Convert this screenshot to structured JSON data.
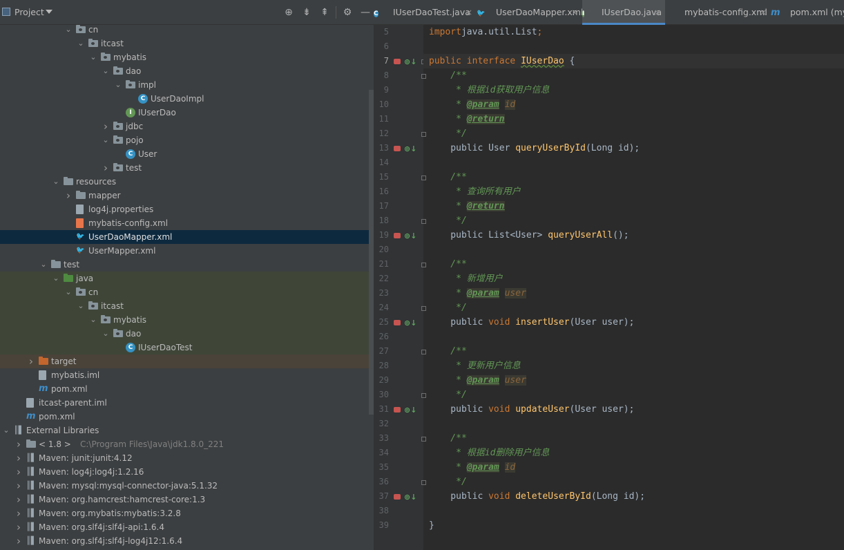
{
  "project": {
    "title": "Project",
    "tree": [
      {
        "label": "cn",
        "depth": 5,
        "arrow": "down",
        "icon": "package-folder"
      },
      {
        "label": "itcast",
        "depth": 6,
        "arrow": "down",
        "icon": "package-folder"
      },
      {
        "label": "mybatis",
        "depth": 7,
        "arrow": "down",
        "icon": "package-folder"
      },
      {
        "label": "dao",
        "depth": 8,
        "arrow": "down",
        "icon": "package-folder"
      },
      {
        "label": "impl",
        "depth": 9,
        "arrow": "down",
        "icon": "package-folder"
      },
      {
        "label": "UserDaoImpl",
        "depth": 10,
        "arrow": "",
        "icon": "class"
      },
      {
        "label": "IUserDao",
        "depth": 9,
        "arrow": "",
        "icon": "interface"
      },
      {
        "label": "jdbc",
        "depth": 8,
        "arrow": "right",
        "icon": "package-folder"
      },
      {
        "label": "pojo",
        "depth": 8,
        "arrow": "down",
        "icon": "package-folder"
      },
      {
        "label": "User",
        "depth": 9,
        "arrow": "",
        "icon": "class"
      },
      {
        "label": "test",
        "depth": 8,
        "arrow": "right",
        "icon": "package-folder"
      },
      {
        "label": "resources",
        "depth": 4,
        "arrow": "down",
        "icon": "resources-folder"
      },
      {
        "label": "mapper",
        "depth": 5,
        "arrow": "right",
        "icon": "folder"
      },
      {
        "label": "log4j.properties",
        "depth": 5,
        "arrow": "",
        "icon": "file"
      },
      {
        "label": "mybatis-config.xml",
        "depth": 5,
        "arrow": "",
        "icon": "xml"
      },
      {
        "label": "UserDaoMapper.xml",
        "depth": 5,
        "arrow": "",
        "icon": "mybatis-xml",
        "state": "selected"
      },
      {
        "label": "UserMapper.xml",
        "depth": 5,
        "arrow": "",
        "icon": "mybatis-xml"
      },
      {
        "label": "test",
        "depth": 3,
        "arrow": "down",
        "icon": "folder"
      },
      {
        "label": "java",
        "depth": 4,
        "arrow": "down",
        "icon": "green-folder",
        "state": "green"
      },
      {
        "label": "cn",
        "depth": 5,
        "arrow": "down",
        "icon": "package-folder",
        "state": "green"
      },
      {
        "label": "itcast",
        "depth": 6,
        "arrow": "down",
        "icon": "package-folder",
        "state": "green"
      },
      {
        "label": "mybatis",
        "depth": 7,
        "arrow": "down",
        "icon": "package-folder",
        "state": "green"
      },
      {
        "label": "dao",
        "depth": 8,
        "arrow": "down",
        "icon": "package-folder",
        "state": "green"
      },
      {
        "label": "IUserDaoTest",
        "depth": 9,
        "arrow": "",
        "icon": "test-class",
        "state": "green"
      },
      {
        "label": "target",
        "depth": 2,
        "arrow": "right",
        "icon": "orange-folder",
        "state": "orange"
      },
      {
        "label": "mybatis.iml",
        "depth": 2,
        "arrow": "",
        "icon": "file"
      },
      {
        "label": "pom.xml",
        "depth": 2,
        "arrow": "",
        "icon": "maven"
      },
      {
        "label": "itcast-parent.iml",
        "depth": 1,
        "arrow": "",
        "icon": "file"
      },
      {
        "label": "pom.xml",
        "depth": 1,
        "arrow": "",
        "icon": "maven"
      },
      {
        "label": "External Libraries",
        "depth": 0,
        "arrow": "down",
        "icon": "library"
      },
      {
        "label": "< 1.8 >",
        "extra": "C:\\Program Files\\Java\\jdk1.8.0_221",
        "depth": 1,
        "arrow": "right",
        "icon": "jdk"
      },
      {
        "label": "Maven: junit:junit:4.12",
        "depth": 1,
        "arrow": "right",
        "icon": "library"
      },
      {
        "label": "Maven: log4j:log4j:1.2.16",
        "depth": 1,
        "arrow": "right",
        "icon": "library"
      },
      {
        "label": "Maven: mysql:mysql-connector-java:5.1.32",
        "depth": 1,
        "arrow": "right",
        "icon": "library"
      },
      {
        "label": "Maven: org.hamcrest:hamcrest-core:1.3",
        "depth": 1,
        "arrow": "right",
        "icon": "library"
      },
      {
        "label": "Maven: org.mybatis:mybatis:3.2.8",
        "depth": 1,
        "arrow": "right",
        "icon": "library"
      },
      {
        "label": "Maven: org.slf4j:slf4j-api:1.6.4",
        "depth": 1,
        "arrow": "right",
        "icon": "library"
      },
      {
        "label": "Maven: org.slf4j:slf4j-log4j12:1.6.4",
        "depth": 1,
        "arrow": "right",
        "icon": "library"
      }
    ]
  },
  "tabs": [
    {
      "label": "IUserDaoTest.java",
      "icon": "test-class",
      "active": false
    },
    {
      "label": "UserDaoMapper.xml",
      "icon": "mybatis-xml",
      "active": false
    },
    {
      "label": "IUserDao.java",
      "icon": "interface",
      "active": true
    },
    {
      "label": "mybatis-config.xml",
      "icon": "xml",
      "active": false
    },
    {
      "label": "pom.xml (mybat",
      "icon": "maven",
      "active": false
    }
  ],
  "editor": {
    "current_line": 7,
    "lines": [
      {
        "n": 5,
        "tokens": [
          [
            "kw",
            "import"
          ],
          [
            "",
            "java.util.List"
          ],
          [
            "kw",
            ";"
          ]
        ]
      },
      {
        "n": 6,
        "tokens": []
      },
      {
        "n": 7,
        "marker": true,
        "fold": true,
        "tokens": [
          [
            "kw",
            "public interface "
          ],
          [
            "iname",
            "IUserDao"
          ],
          [
            "",
            " {"
          ]
        ]
      },
      {
        "n": 8,
        "fold": true,
        "tokens": [
          [
            "doc",
            "    /**"
          ]
        ]
      },
      {
        "n": 9,
        "tokens": [
          [
            "doc",
            "     * 根据id获取用户信息"
          ]
        ]
      },
      {
        "n": 10,
        "tokens": [
          [
            "doc",
            "     * "
          ],
          [
            "tag",
            "@param"
          ],
          [
            "doc",
            " "
          ],
          [
            "pn",
            "id"
          ]
        ]
      },
      {
        "n": 11,
        "tokens": [
          [
            "doc",
            "     * "
          ],
          [
            "tag",
            "@return"
          ]
        ]
      },
      {
        "n": 12,
        "fold": true,
        "tokens": [
          [
            "doc",
            "     */"
          ]
        ]
      },
      {
        "n": 13,
        "marker": true,
        "tokens": [
          [
            "",
            "    public User "
          ],
          [
            "fn",
            "queryUserById"
          ],
          [
            "",
            "(Long id);"
          ]
        ]
      },
      {
        "n": 14,
        "tokens": []
      },
      {
        "n": 15,
        "fold": true,
        "tokens": [
          [
            "doc",
            "    /**"
          ]
        ]
      },
      {
        "n": 16,
        "tokens": [
          [
            "doc",
            "     * 查询所有用户"
          ]
        ]
      },
      {
        "n": 17,
        "tokens": [
          [
            "doc",
            "     * "
          ],
          [
            "tag",
            "@return"
          ]
        ]
      },
      {
        "n": 18,
        "fold": true,
        "tokens": [
          [
            "doc",
            "     */"
          ]
        ]
      },
      {
        "n": 19,
        "marker": true,
        "tokens": [
          [
            "",
            "    public List<User> "
          ],
          [
            "fn",
            "queryUserAll"
          ],
          [
            "",
            "();"
          ]
        ]
      },
      {
        "n": 20,
        "tokens": []
      },
      {
        "n": 21,
        "fold": true,
        "tokens": [
          [
            "doc",
            "    /**"
          ]
        ]
      },
      {
        "n": 22,
        "tokens": [
          [
            "doc",
            "     * 新增用户"
          ]
        ]
      },
      {
        "n": 23,
        "tokens": [
          [
            "doc",
            "     * "
          ],
          [
            "tag",
            "@param"
          ],
          [
            "doc",
            " "
          ],
          [
            "pn",
            "user"
          ]
        ]
      },
      {
        "n": 24,
        "fold": true,
        "tokens": [
          [
            "doc",
            "     */"
          ]
        ]
      },
      {
        "n": 25,
        "marker": true,
        "tokens": [
          [
            "",
            "    public "
          ],
          [
            "kw",
            "void "
          ],
          [
            "fn",
            "insertUser"
          ],
          [
            "",
            "(User user);"
          ]
        ]
      },
      {
        "n": 26,
        "tokens": []
      },
      {
        "n": 27,
        "fold": true,
        "tokens": [
          [
            "doc",
            "    /**"
          ]
        ]
      },
      {
        "n": 28,
        "tokens": [
          [
            "doc",
            "     * 更新用户信息"
          ]
        ]
      },
      {
        "n": 29,
        "tokens": [
          [
            "doc",
            "     * "
          ],
          [
            "tag",
            "@param"
          ],
          [
            "doc",
            " "
          ],
          [
            "pn",
            "user"
          ]
        ]
      },
      {
        "n": 30,
        "fold": true,
        "tokens": [
          [
            "doc",
            "     */"
          ]
        ]
      },
      {
        "n": 31,
        "marker": true,
        "tokens": [
          [
            "",
            "    public "
          ],
          [
            "kw",
            "void "
          ],
          [
            "fn",
            "updateUser"
          ],
          [
            "",
            "(User user);"
          ]
        ]
      },
      {
        "n": 32,
        "tokens": []
      },
      {
        "n": 33,
        "fold": true,
        "tokens": [
          [
            "doc",
            "    /**"
          ]
        ]
      },
      {
        "n": 34,
        "tokens": [
          [
            "doc",
            "     * 根据id删除用户信息"
          ]
        ]
      },
      {
        "n": 35,
        "tokens": [
          [
            "doc",
            "     * "
          ],
          [
            "tag",
            "@param"
          ],
          [
            "doc",
            " "
          ],
          [
            "pn",
            "id"
          ]
        ]
      },
      {
        "n": 36,
        "fold": true,
        "tokens": [
          [
            "doc",
            "     */"
          ]
        ]
      },
      {
        "n": 37,
        "marker": true,
        "tokens": [
          [
            "",
            "    public "
          ],
          [
            "kw",
            "void "
          ],
          [
            "fn",
            "deleteUserById"
          ],
          [
            "",
            "(Long id);"
          ]
        ]
      },
      {
        "n": 38,
        "tokens": []
      },
      {
        "n": 39,
        "tokens": [
          [
            "",
            "}"
          ]
        ]
      }
    ]
  },
  "colors": {
    "accent": "#4a88c7",
    "keyword": "#cc7832",
    "doc": "#629755",
    "method": "#ffc66d",
    "selection": "#0d293e"
  }
}
